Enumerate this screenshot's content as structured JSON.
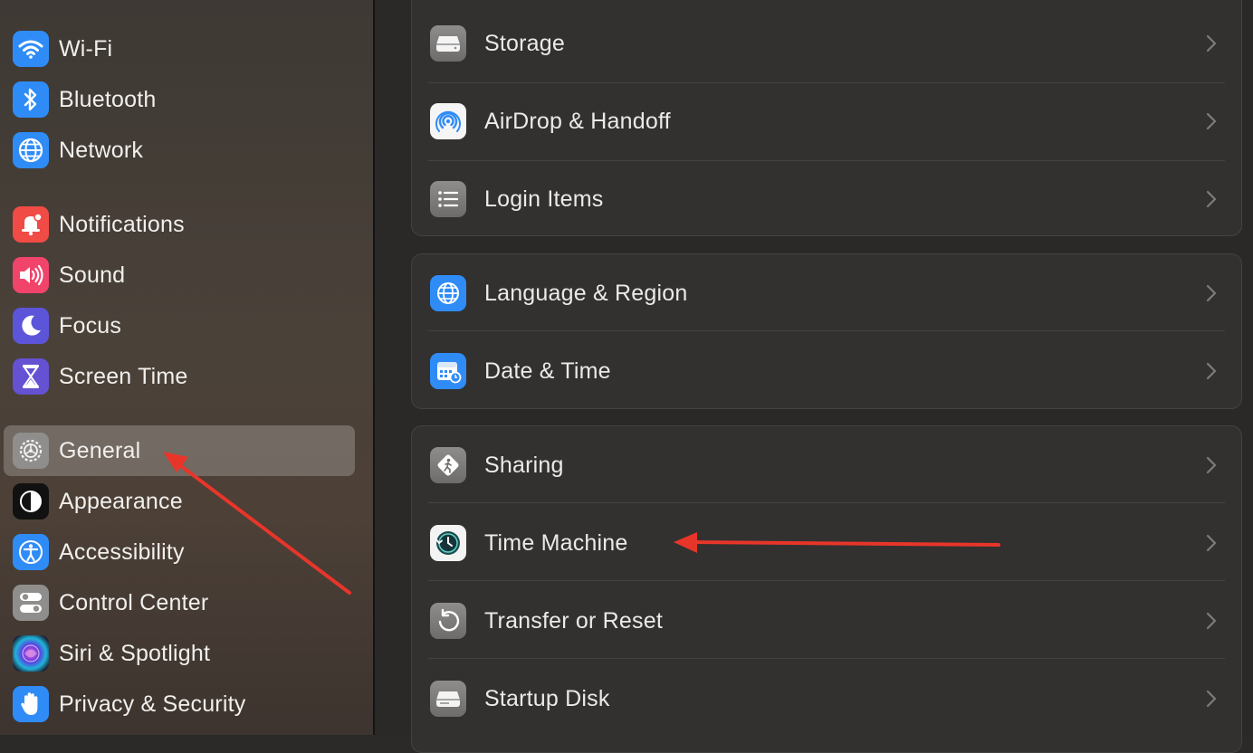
{
  "sidebar": {
    "items": [
      {
        "label": "Wi-Fi",
        "icon": "wifi-icon",
        "color": "#2f8cf7"
      },
      {
        "label": "Bluetooth",
        "icon": "bluetooth-icon",
        "color": "#2f8cf7"
      },
      {
        "label": "Network",
        "icon": "globe-icon",
        "color": "#2f8cf7"
      },
      {
        "label": "Notifications",
        "icon": "bell-icon",
        "color": "#f04b45"
      },
      {
        "label": "Sound",
        "icon": "speaker-icon",
        "color": "#f0446a"
      },
      {
        "label": "Focus",
        "icon": "moon-icon",
        "color": "#5d55d9"
      },
      {
        "label": "Screen Time",
        "icon": "hourglass-icon",
        "color": "#6452d3"
      },
      {
        "label": "General",
        "icon": "gear-icon",
        "color": "#8f8e8c"
      },
      {
        "label": "Appearance",
        "icon": "appearance-icon",
        "color": "#111111"
      },
      {
        "label": "Accessibility",
        "icon": "accessibility-icon",
        "color": "#2f8cf7"
      },
      {
        "label": "Control Center",
        "icon": "toggles-icon",
        "color": "#8f8e8c"
      },
      {
        "label": "Siri & Spotlight",
        "icon": "siri-icon",
        "color": "#1a1a2e"
      },
      {
        "label": "Privacy & Security",
        "icon": "hand-icon",
        "color": "#2f8cf7"
      }
    ],
    "selected": "General"
  },
  "main": {
    "groups": [
      {
        "rows": [
          {
            "label": "Storage",
            "icon": "storage-icon"
          },
          {
            "label": "AirDrop & Handoff",
            "icon": "airdrop-icon"
          },
          {
            "label": "Login Items",
            "icon": "list-icon"
          }
        ]
      },
      {
        "rows": [
          {
            "label": "Language & Region",
            "icon": "globe-icon"
          },
          {
            "label": "Date & Time",
            "icon": "calendar-clock-icon"
          }
        ]
      },
      {
        "rows": [
          {
            "label": "Sharing",
            "icon": "sharing-icon"
          },
          {
            "label": "Time Machine",
            "icon": "time-machine-icon"
          },
          {
            "label": "Transfer or Reset",
            "icon": "reset-icon"
          },
          {
            "label": "Startup Disk",
            "icon": "disk-icon"
          }
        ]
      }
    ]
  },
  "annotations": {
    "arrow_color": "#e8352a"
  }
}
